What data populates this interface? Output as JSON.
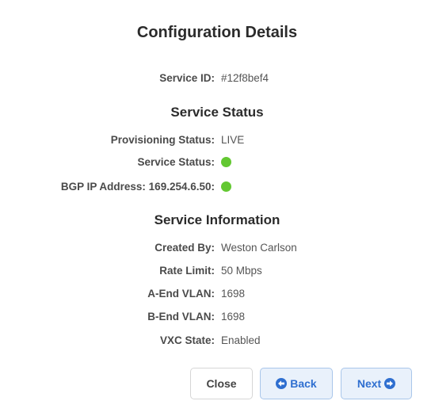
{
  "dialog": {
    "title": "Configuration Details"
  },
  "service_id": {
    "label": "Service ID:",
    "value": "#12f8bef4"
  },
  "service_status": {
    "heading": "Service Status",
    "provisioning_label": "Provisioning Status:",
    "provisioning_value": "LIVE",
    "status_label": "Service Status:",
    "status_indicator": "green-dot",
    "bgp_label": "BGP IP Address: 169.254.6.50:",
    "bgp_indicator": "green-dot"
  },
  "service_information": {
    "heading": "Service Information",
    "created_by_label": "Created By:",
    "created_by_value": "Weston Carlson",
    "rate_limit_label": "Rate Limit:",
    "rate_limit_value": "50 Mbps",
    "a_end_vlan_label": "A-End VLAN:",
    "a_end_vlan_value": "1698",
    "b_end_vlan_label": "B-End VLAN:",
    "b_end_vlan_value": "1698",
    "vxc_state_label": "VXC State:",
    "vxc_state_value": "Enabled"
  },
  "buttons": {
    "close_label": "Close",
    "back_label": "Back",
    "back_icon": "arrow-circle-left-icon",
    "next_label": "Next",
    "next_icon": "arrow-circle-right-icon"
  },
  "colors": {
    "status_green": "#63c832",
    "accent_blue": "#2f6fd0"
  }
}
